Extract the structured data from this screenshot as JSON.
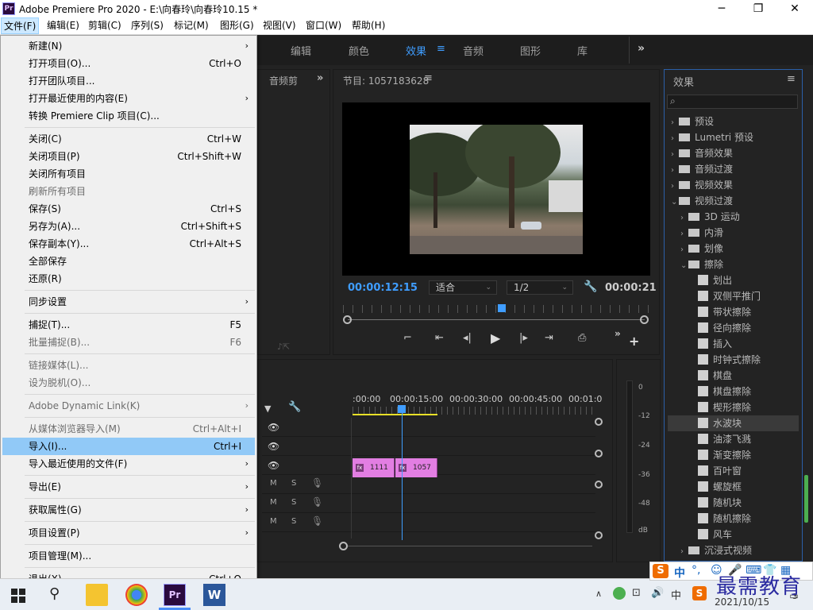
{
  "window": {
    "app_logo": "Pr",
    "title": "Adobe Premiere Pro 2020 - E:\\向春玲\\向春玲10.15 *",
    "controls": [
      "─",
      "❐",
      "✕"
    ]
  },
  "menubar": [
    {
      "label": "文件(F)",
      "active": true
    },
    {
      "label": "编辑(E)"
    },
    {
      "label": "剪辑(C)"
    },
    {
      "label": "序列(S)"
    },
    {
      "label": "标记(M)"
    },
    {
      "label": "图形(G)"
    },
    {
      "label": "视图(V)"
    },
    {
      "label": "窗口(W)"
    },
    {
      "label": "帮助(H)"
    }
  ],
  "workspace_tabs": [
    {
      "label": "编辑"
    },
    {
      "label": "颜色"
    },
    {
      "label": "效果",
      "active": true
    },
    {
      "label": "音频"
    },
    {
      "label": "图形"
    },
    {
      "label": "库"
    }
  ],
  "left_panel": {
    "title": "音频剪"
  },
  "program_monitor": {
    "title": "节目: 1057183628",
    "timecode_current": "00:00:12:15",
    "fit_select": "适合",
    "resolution_select": "1/2",
    "timecode_duration": "00:00:21",
    "playhead_progress": 0.52
  },
  "timeline": {
    "ruler_labels": [
      ":00:00",
      "00:00:15:00",
      "00:00:30:00",
      "00:00:45:00",
      "00:01:0"
    ],
    "clips": [
      {
        "label": "1111",
        "icon": "fx"
      },
      {
        "label": "1057",
        "icon": "fx"
      }
    ],
    "audio_track_buttons": [
      "M",
      "S"
    ]
  },
  "audio_meter": {
    "labels": [
      "0",
      "-12",
      "-24",
      "-36",
      "-48",
      "dB"
    ]
  },
  "effects_panel": {
    "title": "效果",
    "search_placeholder": "",
    "items": [
      {
        "label": "预设",
        "type": "folder",
        "level": 0,
        "open": false
      },
      {
        "label": "Lumetri 预设",
        "type": "folder",
        "level": 0,
        "open": false
      },
      {
        "label": "音频效果",
        "type": "folder",
        "level": 0,
        "open": false
      },
      {
        "label": "音频过渡",
        "type": "folder",
        "level": 0,
        "open": false
      },
      {
        "label": "视频效果",
        "type": "folder",
        "level": 0,
        "open": false
      },
      {
        "label": "视频过渡",
        "type": "folder",
        "level": 0,
        "open": true
      },
      {
        "label": "3D 运动",
        "type": "folder",
        "level": 1,
        "open": false
      },
      {
        "label": "内滑",
        "type": "folder",
        "level": 1,
        "open": false
      },
      {
        "label": "划像",
        "type": "folder",
        "level": 1,
        "open": false
      },
      {
        "label": "擦除",
        "type": "folder",
        "level": 1,
        "open": true
      },
      {
        "label": "划出",
        "type": "effect",
        "level": 2
      },
      {
        "label": "双侧平推门",
        "type": "effect",
        "level": 2
      },
      {
        "label": "带状擦除",
        "type": "effect",
        "level": 2
      },
      {
        "label": "径向擦除",
        "type": "effect",
        "level": 2
      },
      {
        "label": "插入",
        "type": "effect",
        "level": 2
      },
      {
        "label": "时钟式擦除",
        "type": "effect",
        "level": 2
      },
      {
        "label": "棋盘",
        "type": "effect",
        "level": 2
      },
      {
        "label": "棋盘擦除",
        "type": "effect",
        "level": 2
      },
      {
        "label": "楔形擦除",
        "type": "effect",
        "level": 2
      },
      {
        "label": "水波块",
        "type": "effect",
        "level": 2,
        "selected": true
      },
      {
        "label": "油漆飞溅",
        "type": "effect",
        "level": 2
      },
      {
        "label": "渐变擦除",
        "type": "effect",
        "level": 2
      },
      {
        "label": "百叶窗",
        "type": "effect",
        "level": 2
      },
      {
        "label": "螺旋框",
        "type": "effect",
        "level": 2
      },
      {
        "label": "随机块",
        "type": "effect",
        "level": 2
      },
      {
        "label": "随机擦除",
        "type": "effect",
        "level": 2
      },
      {
        "label": "风车",
        "type": "effect",
        "level": 2
      },
      {
        "label": "沉浸式视频",
        "type": "folder",
        "level": 1,
        "open": false
      }
    ]
  },
  "file_menu": {
    "groups": [
      [
        {
          "label": "新建(N)",
          "submenu": true
        },
        {
          "label": "打开项目(O)...",
          "shortcut": "Ctrl+O"
        },
        {
          "label": "打开团队项目..."
        },
        {
          "label": "打开最近使用的内容(E)",
          "submenu": true
        },
        {
          "label": "转换 Premiere Clip 项目(C)..."
        }
      ],
      [
        {
          "label": "关闭(C)",
          "shortcut": "Ctrl+W"
        },
        {
          "label": "关闭项目(P)",
          "shortcut": "Ctrl+Shift+W"
        },
        {
          "label": "关闭所有项目"
        },
        {
          "label": "刷新所有项目",
          "disabled": true
        },
        {
          "label": "保存(S)",
          "shortcut": "Ctrl+S"
        },
        {
          "label": "另存为(A)...",
          "shortcut": "Ctrl+Shift+S"
        },
        {
          "label": "保存副本(Y)...",
          "shortcut": "Ctrl+Alt+S"
        },
        {
          "label": "全部保存"
        },
        {
          "label": "还原(R)"
        }
      ],
      [
        {
          "label": "同步设置",
          "submenu": true
        }
      ],
      [
        {
          "label": "捕捉(T)...",
          "shortcut": "F5"
        },
        {
          "label": "批量捕捉(B)...",
          "shortcut": "F6",
          "disabled": true
        }
      ],
      [
        {
          "label": "链接媒体(L)...",
          "disabled": true
        },
        {
          "label": "设为脱机(O)...",
          "disabled": true
        }
      ],
      [
        {
          "label": "Adobe Dynamic Link(K)",
          "submenu": true,
          "disabled": true
        }
      ],
      [
        {
          "label": "从媒体浏览器导入(M)",
          "shortcut": "Ctrl+Alt+I",
          "disabled": true
        },
        {
          "label": "导入(I)...",
          "shortcut": "Ctrl+I",
          "highlighted": true
        },
        {
          "label": "导入最近使用的文件(F)",
          "submenu": true
        }
      ],
      [
        {
          "label": "导出(E)",
          "submenu": true
        }
      ],
      [
        {
          "label": "获取属性(G)",
          "submenu": true
        }
      ],
      [
        {
          "label": "项目设置(P)",
          "submenu": true
        }
      ],
      [
        {
          "label": "项目管理(M)..."
        }
      ],
      [
        {
          "label": "退出(X)",
          "shortcut": "Ctrl+Q"
        }
      ]
    ]
  },
  "taskbar": {
    "clock_time": "",
    "clock_date": "2021/10/15",
    "tray_ime": "中",
    "notification_count": "3"
  },
  "ime_bar": {
    "mode": "中"
  },
  "watermark": "最需教育",
  "colors": {
    "accent_blue": "#3f9dff",
    "clip_pink": "#e27ee2",
    "menu_highlight": "#91c9f7",
    "panel_bg": "#232323"
  }
}
